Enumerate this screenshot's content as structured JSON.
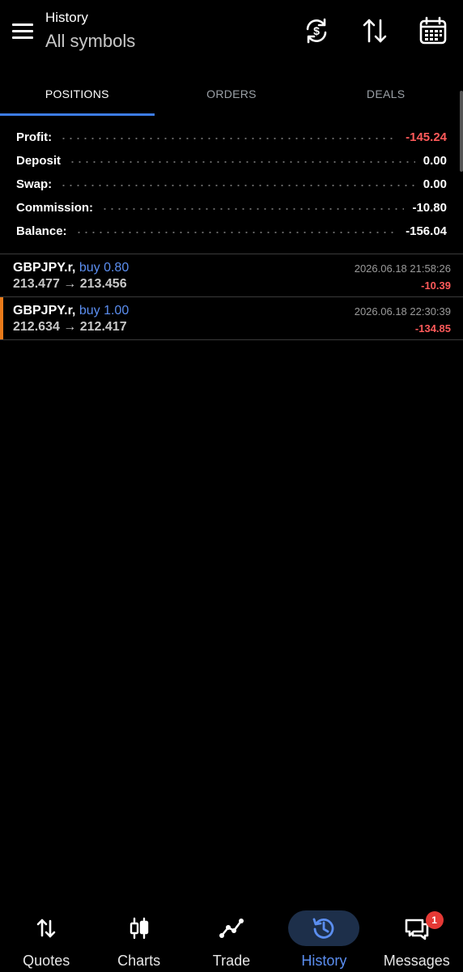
{
  "header": {
    "title": "History",
    "subtitle": "All symbols",
    "icons": [
      "menu-icon",
      "currency-sync-icon",
      "sort-icon",
      "calendar-icon"
    ]
  },
  "tabs": [
    {
      "label": "POSITIONS",
      "active": true
    },
    {
      "label": "ORDERS",
      "active": false
    },
    {
      "label": "DEALS",
      "active": false
    }
  ],
  "summary": [
    {
      "label": "Profit:",
      "value": "-145.24",
      "negative": true
    },
    {
      "label": "Deposit",
      "value": "0.00",
      "negative": false
    },
    {
      "label": "Swap:",
      "value": "0.00",
      "negative": false
    },
    {
      "label": "Commission:",
      "value": "-10.80",
      "negative": false
    },
    {
      "label": "Balance:",
      "value": "-156.04",
      "negative": false
    }
  ],
  "positions": [
    {
      "symbol": "GBPJPY.r,",
      "side": "buy 0.80",
      "open_price": "213.477",
      "arrow": "→",
      "close_price": "213.456",
      "time": "2026.06.18 21:58:26",
      "profit": "-10.39",
      "selected": false
    },
    {
      "symbol": "GBPJPY.r,",
      "side": "buy 1.00",
      "open_price": "212.634",
      "arrow": "→",
      "close_price": "212.417",
      "time": "2026.06.18 22:30:39",
      "profit": "-134.85",
      "selected": true
    }
  ],
  "nav": [
    {
      "label": "Quotes",
      "icon": "quotes-icon",
      "active": false
    },
    {
      "label": "Charts",
      "icon": "charts-icon",
      "active": false
    },
    {
      "label": "Trade",
      "icon": "trade-icon",
      "active": false
    },
    {
      "label": "History",
      "icon": "history-icon",
      "active": true
    },
    {
      "label": "Messages",
      "icon": "messages-icon",
      "active": false,
      "badge": "1"
    }
  ],
  "colors": {
    "background": "#000000",
    "accent": "#3d7ce8",
    "negative": "#ff5a5a",
    "selection_marker": "#e87a1a",
    "badge": "#e53935"
  }
}
